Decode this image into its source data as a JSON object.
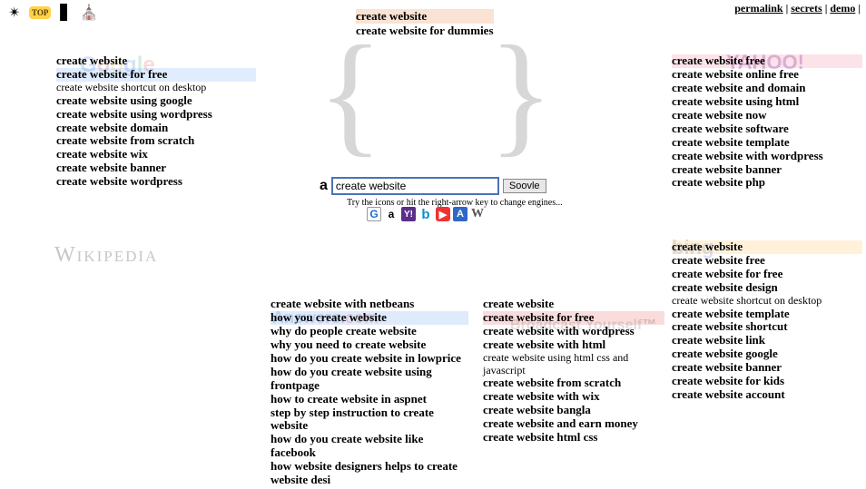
{
  "toplinks": {
    "permalink": "permalink",
    "secrets": "secrets",
    "demo": "demo"
  },
  "toolbar": {
    "top_label": "TOP"
  },
  "search": {
    "engine_glyph": "a",
    "value": "create website",
    "button": "Soovle",
    "hint": "Try the icons or hit the right-arrow key to change engines..."
  },
  "engines": {
    "google": "G",
    "amazon": "a",
    "yahoo": "Y!",
    "bing": "b",
    "youtube": "▶",
    "answers": "A",
    "wikipedia": "W"
  },
  "wikipedia_label": "Wikipedia",
  "amazon": {
    "items": [
      "create website",
      "create website for dummies"
    ],
    "hl_index": 0
  },
  "google": {
    "items": [
      "create website",
      "create website for free",
      "create website shortcut on desktop",
      "create website using google",
      "create website using wordpress",
      "create website domain",
      "create website from scratch",
      "create website wix",
      "create website banner",
      "create website wordpress"
    ],
    "hl_index": 1,
    "small": [
      2
    ]
  },
  "yahoo": {
    "items": [
      "create website free",
      "create website online free",
      "create website and domain",
      "create website using html",
      "create website now",
      "create website software",
      "create website template",
      "create website with wordpress",
      "create website banner",
      "create website php"
    ],
    "hl_index": 0
  },
  "bing": {
    "items": [
      "create website",
      "create website free",
      "create website for free",
      "create website design",
      "create website shortcut on desktop",
      "create website template",
      "create website shortcut",
      "create website link",
      "create website google",
      "create website banner",
      "create website for kids",
      "create website account"
    ],
    "hl_index": 0,
    "small": [
      4
    ]
  },
  "answers": {
    "items": [
      "create website with netbeans",
      "how you create website",
      "why do people create website",
      "why you need to create website",
      "how do you create website in lowprice",
      "how do you create website using frontpage",
      "how to create website in aspnet",
      "step by step instruction to create website",
      "how do you create website like facebook",
      "how website designers helps to create website desi"
    ],
    "hl_index": 1
  },
  "youtube": {
    "items": [
      "create website",
      "create website for free",
      "create website with wordpress",
      "create website with html",
      "create website using html css and javascript",
      "create website from scratch",
      "create website with wix",
      "create website bangla",
      "create website and earn money",
      "create website html css"
    ],
    "hl_index": 1,
    "small": [
      4
    ]
  }
}
